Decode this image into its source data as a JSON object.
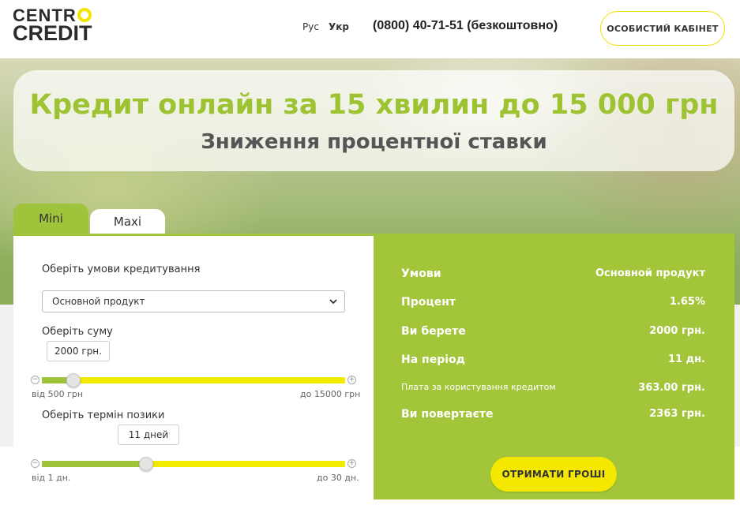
{
  "header": {
    "logo_top": "CENTR",
    "logo_bottom": "CREDIT",
    "lang_ru": "Рус",
    "lang_uk": "Укр",
    "phone": "(0800) 40-71-51 (безкоштовно)",
    "cabinet_button": "ОСОБИСТИЙ КАБІНЕТ"
  },
  "hero": {
    "title": "Кредит онлайн за 15 хвилин до 15 000 грн",
    "subtitle": "Зниження процентної ставки"
  },
  "tabs": [
    {
      "label": "Mini",
      "active": true
    },
    {
      "label": "Maxi",
      "active": false
    }
  ],
  "calculator": {
    "conditions_label": "Оберіть умови кредитування",
    "product_select": "Основной продукт",
    "amount_label": "Оберіть суму",
    "amount_value": "2000 грн.",
    "amount_min": "від 500 грн",
    "amount_max": "до 15000 грн",
    "amount_fraction": 0.1034,
    "term_label": "Оберіть термін позики",
    "term_value": "11 дней",
    "term_min": "від 1 дн.",
    "term_max": "до 30 дн.",
    "term_fraction": 0.3448
  },
  "result": {
    "rows": [
      {
        "key": "Умови",
        "value": "Основной продукт"
      },
      {
        "key": "Процент",
        "value": "1.65%"
      },
      {
        "key": "Ви берете",
        "value": "2000 грн."
      },
      {
        "key": "На період",
        "value": "11 дн."
      },
      {
        "key": "Плата за користування кредитом",
        "value": "363.00 грн."
      },
      {
        "key": "Ви повертаєте",
        "value": "2363 грн."
      }
    ],
    "button": "ОТРИМАТИ ГРОШІ"
  },
  "colors": {
    "accent_green": "#a3c53a",
    "accent_yellow": "#f4e800",
    "title_green": "#9dc332"
  }
}
